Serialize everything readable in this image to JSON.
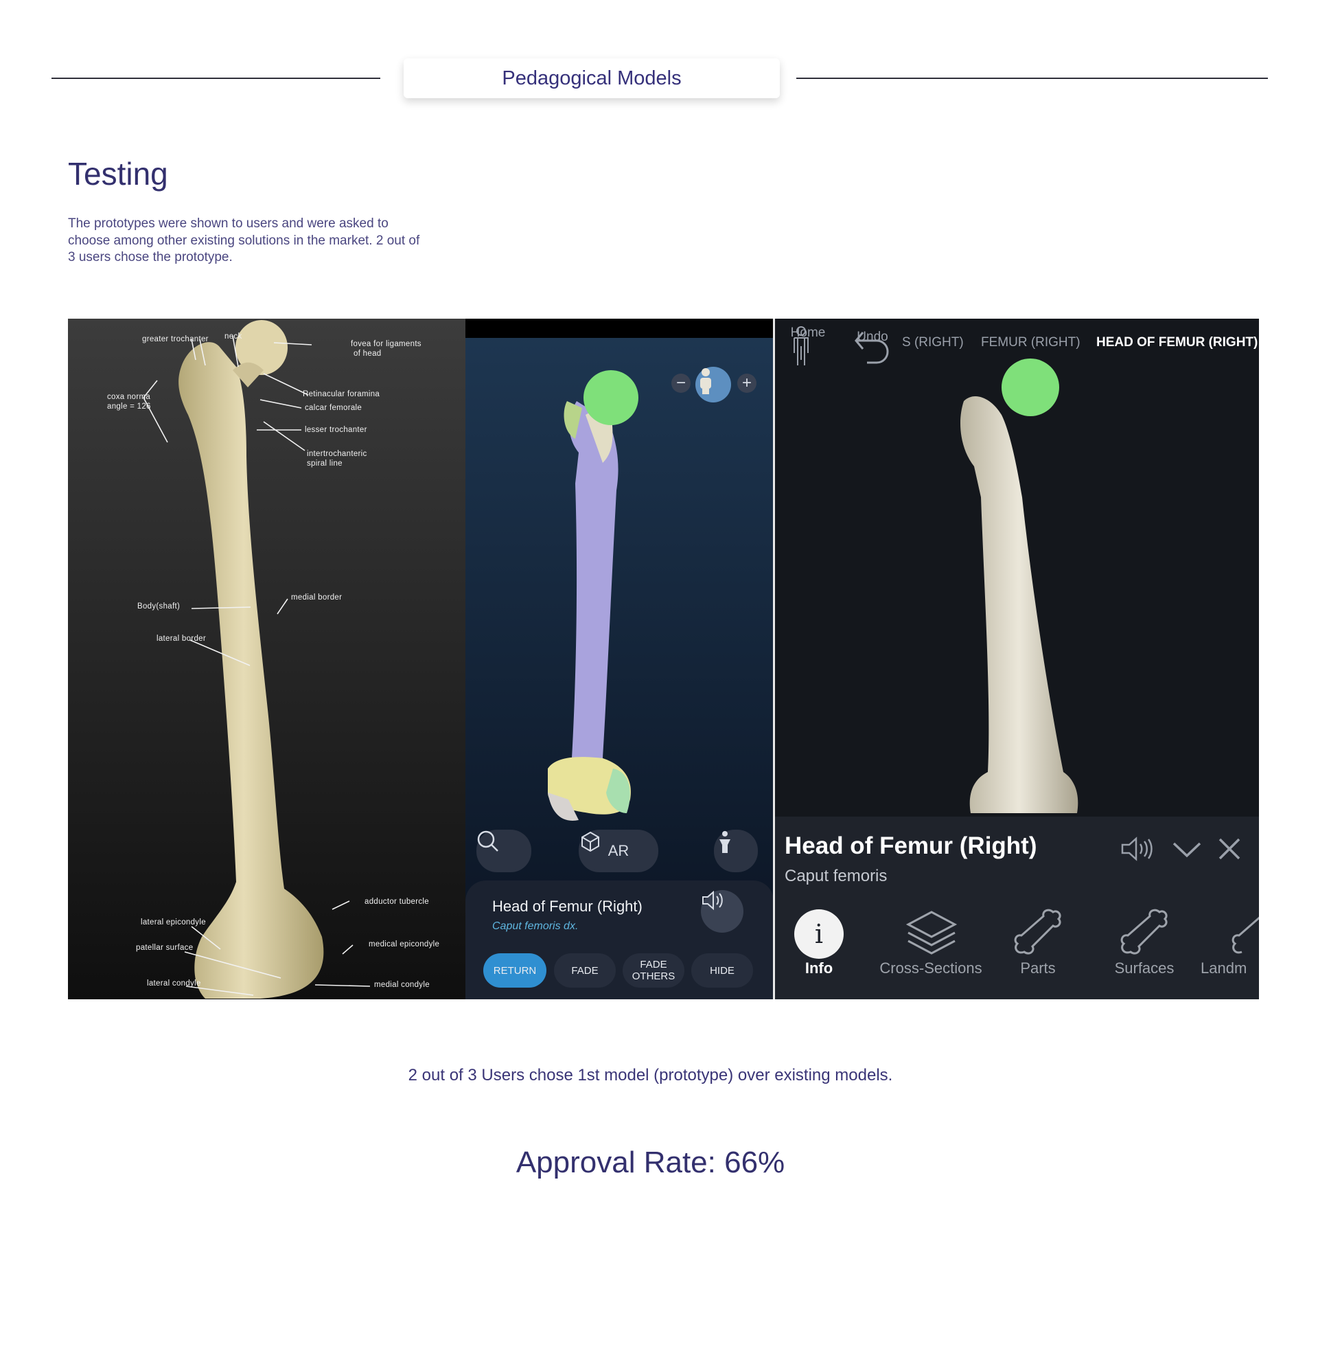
{
  "header": {
    "section_label": "Pedagogical Models"
  },
  "testing": {
    "title": "Testing",
    "description": "The prototypes were shown to users and were asked to choose among other existing solutions in the market. 2 out of 3 users chose the prototype."
  },
  "panel_prototype": {
    "labels": {
      "greater_trochanter": "greater trochanter",
      "neck": "neck",
      "fovea": "fovea for ligaments",
      "fovea2": "of head",
      "coxa": "coxa norma",
      "coxa2": "angle = 126",
      "retinacular": "Retinacular foramina",
      "calcar": "calcar femorale",
      "lesser": "lesser trochanter",
      "intertroch": "intertrochanteric",
      "intertroch2": "spiral line",
      "medial_border": "medial border",
      "body": "Body(shaft)",
      "lateral_border": "lateral border",
      "adductor": "adductor tubercle",
      "lateral_epicondyle": "lateral epicondyle",
      "patellar": "patellar surface",
      "medial_epicondyle": "medical epicondyle",
      "lateral_condyle": "lateral condyle",
      "medial_condyle": "medial condyle"
    }
  },
  "panel_app2": {
    "ar_label": "AR",
    "title": "Head of Femur (Right)",
    "subtitle": "Caput femoris dx.",
    "buttons": {
      "return": "RETURN",
      "fade": "FADE",
      "fade_others_1": "FADE",
      "fade_others_2": "OTHERS",
      "hide": "HIDE"
    }
  },
  "panel_app3": {
    "nav": {
      "home": "Home",
      "undo": "Undo"
    },
    "breadcrumbs": [
      "S (RIGHT)",
      "FEMUR (RIGHT)",
      "HEAD OF FEMUR (RIGHT)"
    ],
    "title": "Head of Femur (Right)",
    "subtitle": "Caput femoris",
    "info_glyph": "i",
    "tabs": [
      "Info",
      "Cross-Sections",
      "Parts",
      "Surfaces",
      "Landm"
    ]
  },
  "caption": "2 out of 3 Users chose 1st model (prototype) over existing models.",
  "approval": "Approval Rate: 66%",
  "colors": {
    "heading": "#33306e",
    "highlight_green": "#7fe07a",
    "shaft_purple": "#a9a3dd",
    "bone": "#d8cfa4"
  }
}
